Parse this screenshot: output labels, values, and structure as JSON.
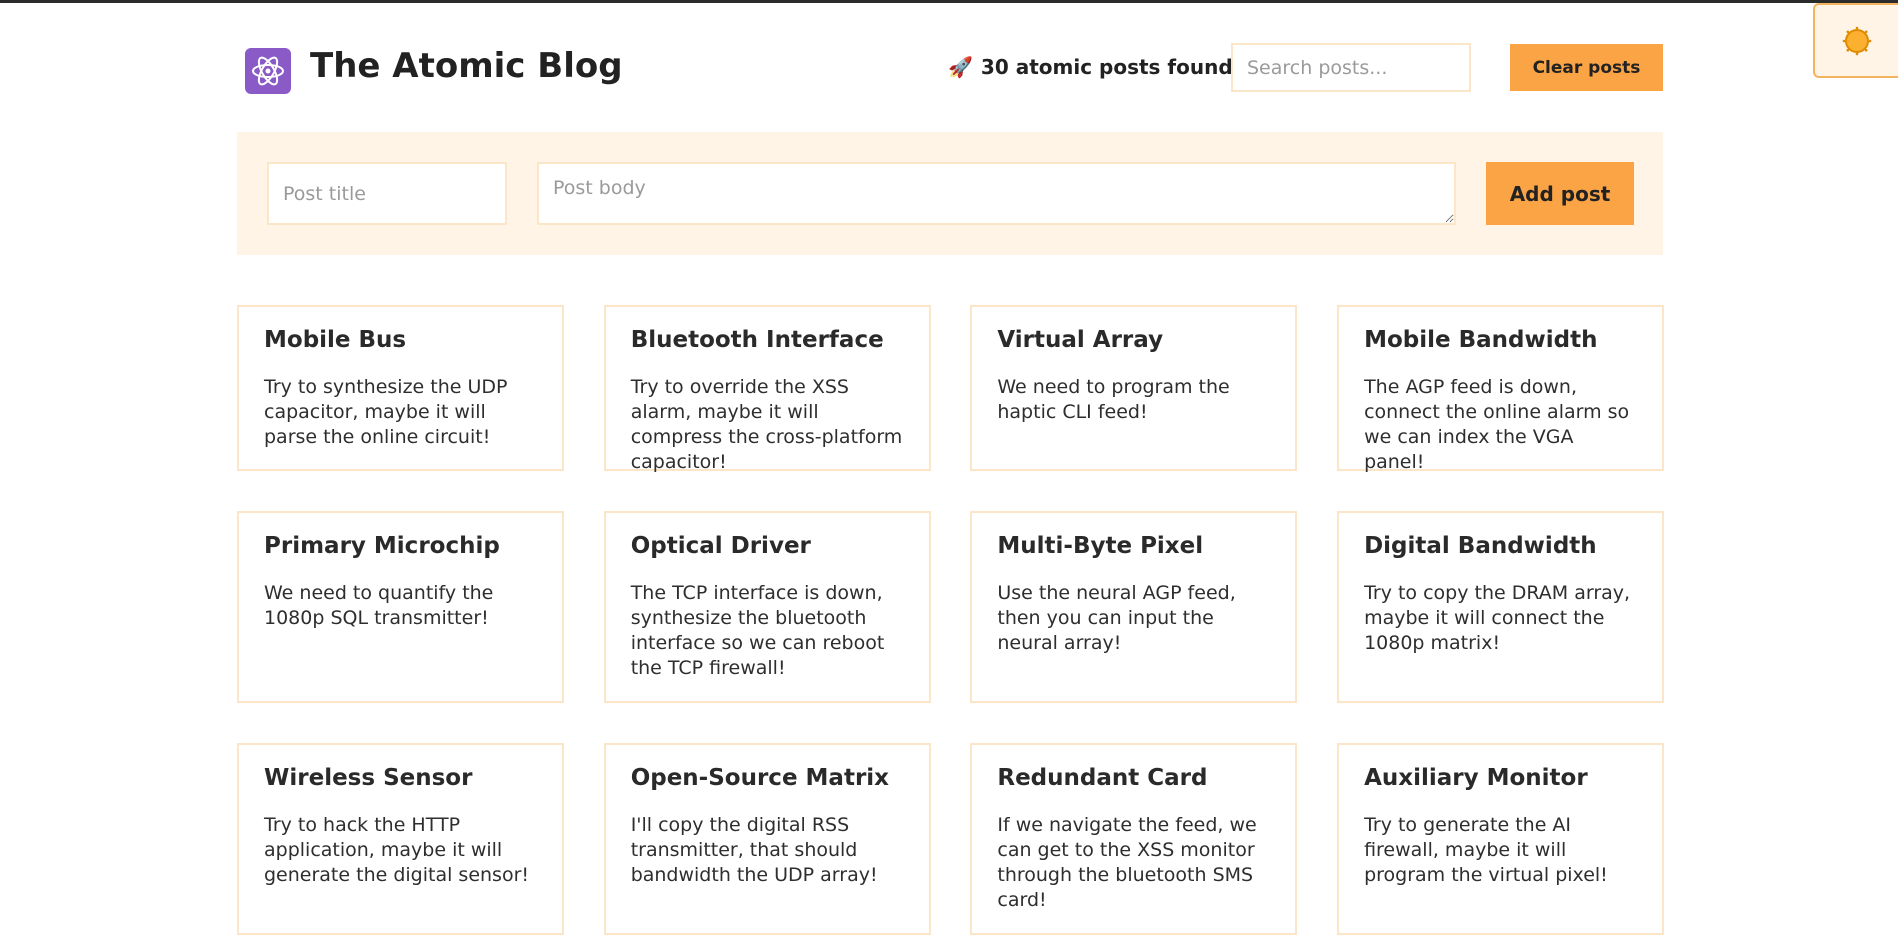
{
  "header": {
    "title": "The Atomic Blog",
    "post_count_text": "30 atomic posts found",
    "search_placeholder": "Search posts...",
    "clear_label": "Clear posts",
    "logo_icon": "atom-icon",
    "count_icon": "rocket-icon"
  },
  "form": {
    "title_placeholder": "Post title",
    "body_placeholder": "Post body",
    "add_label": "Add post"
  },
  "theme_toggle": {
    "icon": "sun-icon"
  },
  "colors": {
    "accent": "#faa446",
    "panel": "#fff4e6",
    "border": "#fbe6c8",
    "logo_bg": "#8a5ac7"
  },
  "posts": [
    {
      "title": "Mobile Bus",
      "body": "Try to synthesize the UDP capacitor, maybe it will parse the online circuit!"
    },
    {
      "title": "Bluetooth Interface",
      "body": "Try to override the XSS alarm, maybe it will compress the cross-platform capacitor!"
    },
    {
      "title": "Virtual Array",
      "body": "We need to program the haptic CLI feed!"
    },
    {
      "title": "Mobile Bandwidth",
      "body": "The AGP feed is down, connect the online alarm so we can index the VGA panel!"
    },
    {
      "title": "Primary Microchip",
      "body": "We need to quantify the 1080p SQL transmitter!"
    },
    {
      "title": "Optical Driver",
      "body": "The TCP interface is down, synthesize the bluetooth interface so we can reboot the TCP firewall!"
    },
    {
      "title": "Multi-Byte Pixel",
      "body": "Use the neural AGP feed, then you can input the neural array!"
    },
    {
      "title": "Digital Bandwidth",
      "body": "Try to copy the DRAM array, maybe it will connect the 1080p matrix!"
    },
    {
      "title": "Wireless Sensor",
      "body": "Try to hack the HTTP application, maybe it will generate the digital sensor!"
    },
    {
      "title": "Open-Source Matrix",
      "body": "I'll copy the digital RSS transmitter, that should bandwidth the UDP array!"
    },
    {
      "title": "Redundant Card",
      "body": "If we navigate the feed, we can get to the XSS monitor through the bluetooth SMS card!"
    },
    {
      "title": "Auxiliary Monitor",
      "body": "Try to generate the AI firewall, maybe it will program the virtual pixel!"
    }
  ]
}
